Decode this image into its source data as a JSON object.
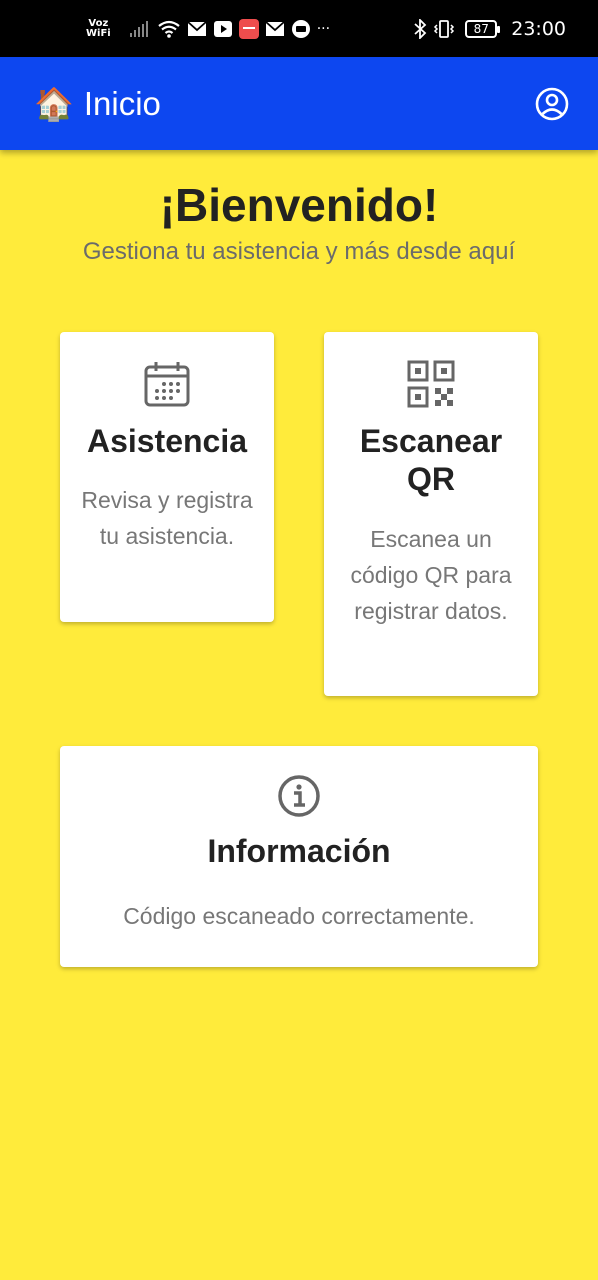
{
  "status_bar": {
    "voz": "Voz",
    "wifi": "WiFi",
    "more": "···",
    "battery": "87",
    "time": "23:00"
  },
  "app_bar": {
    "emoji": "🏠",
    "title": "Inicio",
    "background": "#0d47f0"
  },
  "welcome": {
    "title": "¡Bienvenido!",
    "subtitle": "Gestiona tu asistencia y más desde aquí"
  },
  "cards": {
    "asistencia": {
      "icon": "calendar-icon",
      "title": "Asistencia",
      "description": "Revisa y registra tu asistencia."
    },
    "qr": {
      "icon": "qr-code-icon",
      "title": "Escanear QR",
      "description": "Escanea un código QR para registrar datos."
    },
    "info": {
      "icon": "info-icon",
      "title": "Información",
      "description": "Código escaneado correctamente."
    }
  },
  "colors": {
    "page_background": "#ffeb3b",
    "card_background": "#ffffff"
  }
}
